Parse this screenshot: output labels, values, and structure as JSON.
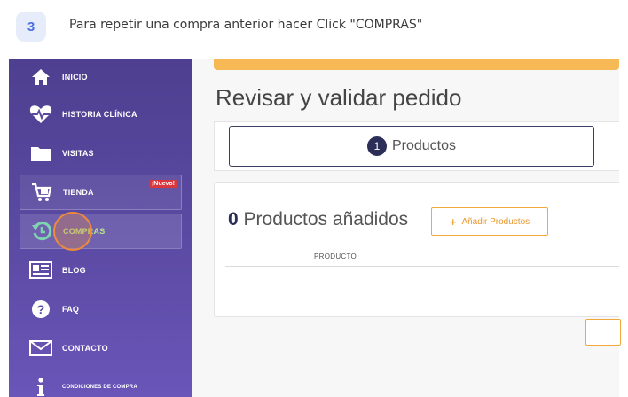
{
  "step": {
    "number": "3",
    "instruction": "Para repetir una compra anterior hacer Click \"COMPRAS\""
  },
  "sidebar": {
    "items": [
      {
        "label": "INICIO",
        "icon": "home-icon"
      },
      {
        "label": "HISTORIA CLÍNICA",
        "icon": "heartbeat-icon"
      },
      {
        "label": "VISITAS",
        "icon": "folder-icon"
      },
      {
        "label": "TIENDA",
        "icon": "cart-icon",
        "badge": "¡Nuevo!"
      },
      {
        "label": "COMPRAS",
        "icon": "history-icon"
      },
      {
        "label": "BLOG",
        "icon": "newspaper-icon"
      },
      {
        "label": "FAQ",
        "icon": "question-icon"
      },
      {
        "label": "CONTACTO",
        "icon": "envelope-icon"
      },
      {
        "label": "CONDICIONES DE COMPRA",
        "icon": "info-icon"
      }
    ]
  },
  "main": {
    "title": "Revisar y validar pedido",
    "tab": {
      "number": "1",
      "label": "Productos"
    },
    "products": {
      "count": "0",
      "title_suffix": " Productos añadidos",
      "add_button": "Añadir Productos",
      "column_header": "PRODUCTO"
    }
  },
  "colors": {
    "sidebar": "#5a4aa2",
    "accent": "#f2a93b",
    "highlight": "#f08a3a",
    "active_label": "#b7e38a",
    "badge": "#d9363e",
    "navy": "#2b2f58"
  }
}
